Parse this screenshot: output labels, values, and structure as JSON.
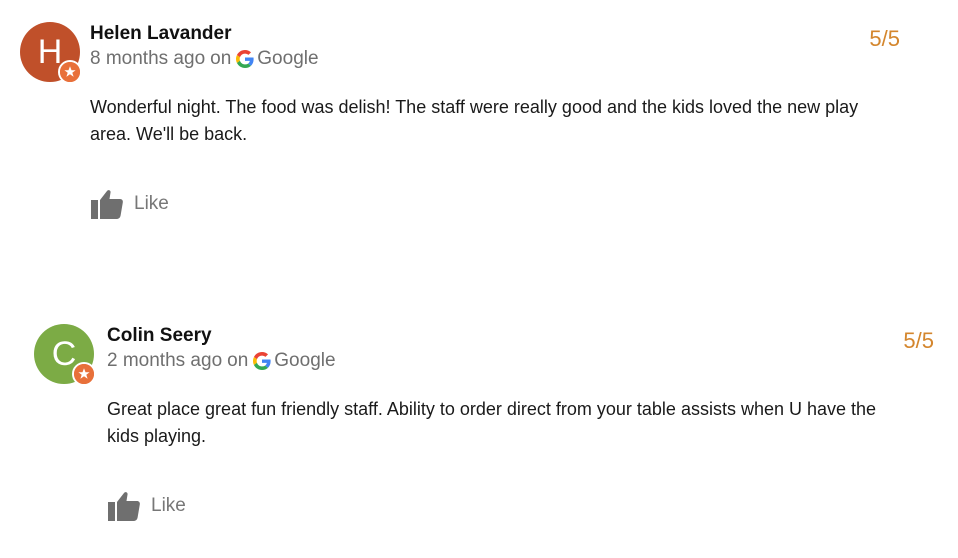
{
  "reviews": [
    {
      "author": "Helen Lavander",
      "avatar_letter": "H",
      "avatar_color": "#c0502a",
      "time": "8 months ago",
      "on_label": "on",
      "source": "Google",
      "text": "Wonderful night. The food was delish! The staff were really good and the kids loved the new play area.  We'll be back.",
      "like_label": "Like",
      "rating": "5/5"
    },
    {
      "author": "Colin Seery",
      "avatar_letter": "C",
      "avatar_color": "#7cab45",
      "time": "2 months ago",
      "on_label": "on",
      "source": "Google",
      "text": "Great place great fun friendly staff. Ability to order direct from your table assists when U have the kids playing.",
      "like_label": "Like",
      "rating": "5/5"
    }
  ],
  "colors": {
    "rating": "#d4862d",
    "badge": "#e8703a",
    "meta_text": "#6f6f6f",
    "like_icon": "#6f6f6f"
  },
  "icons": {
    "source_icon": "google-g-icon",
    "badge_icon": "local-guide-star-icon",
    "like_icon": "thumbs-up-icon"
  }
}
